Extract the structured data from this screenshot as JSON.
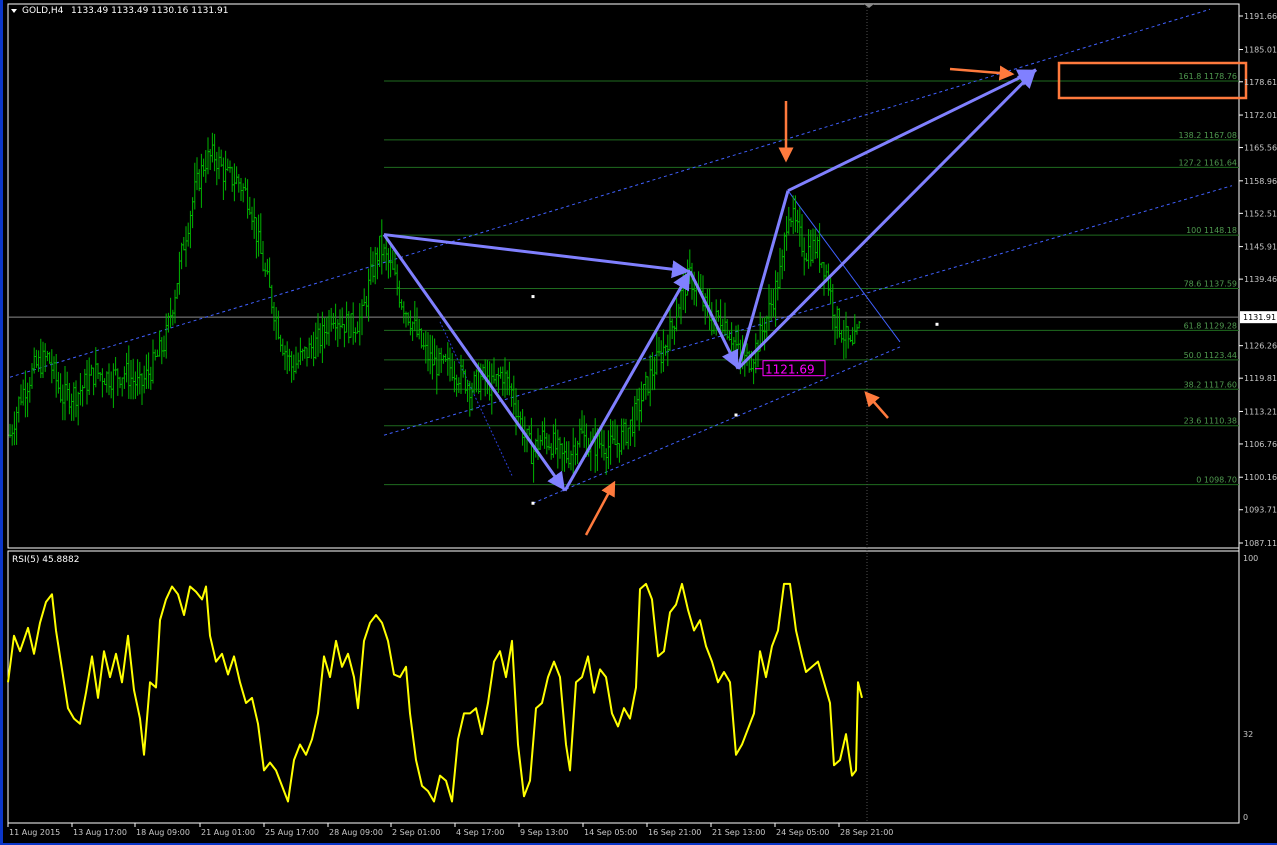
{
  "window": {
    "symbol_label": "GOLD,H4",
    "ohlc_label": "1133.49 1133.49 1130.16 1131.91",
    "rsi_label": "RSI(5) 45.8882"
  },
  "colors": {
    "background": "#000000",
    "bar": "#00b400",
    "grid_line": "#1f6b1f",
    "fib_text": "#4f9a4f",
    "axis_text": "#c8c8c8",
    "pattern": "#8080ff",
    "channel": "#4060ff",
    "arrow": "#ff7a3d",
    "target_box": "#ff7a3d",
    "rsi_line": "#ffff00",
    "price_label_box": "#ff00ff",
    "pane_border": "#ffffff",
    "crosshair": "#8a8a8a"
  },
  "chart_data": [
    {
      "type": "ohlc",
      "symbol": "GOLD",
      "timeframe": "H4",
      "current_price": "1131.91",
      "ylim": [
        1087.11,
        1191.66
      ],
      "y_ticks": [
        "1191.66",
        "1185.01",
        "1178.61",
        "1172.01",
        "1165.56",
        "1158.96",
        "1152.51",
        "1145.91",
        "1139.46",
        "1131.91",
        "1126.26",
        "1119.81",
        "1113.21",
        "1106.76",
        "1100.16",
        "1093.71",
        "1087.11"
      ],
      "x_ticks": [
        "11 Aug 2015",
        "13 Aug 17:00",
        "18 Aug 09:00",
        "21 Aug 01:00",
        "25 Aug 17:00",
        "28 Aug 09:00",
        "2 Sep 01:00",
        "4 Sep 17:00",
        "9 Sep 13:00",
        "14 Sep 05:00",
        "16 Sep 21:00",
        "21 Sep 13:00",
        "24 Sep 05:00",
        "28 Sep 21:00"
      ],
      "fib_levels": [
        {
          "label": "161.8 1178.76",
          "value": 1178.76
        },
        {
          "label": "138.2 1167.08",
          "value": 1167.08
        },
        {
          "label": "127.2 1161.64",
          "value": 1161.64
        },
        {
          "label": "100 1148.18",
          "value": 1148.18
        },
        {
          "label": "78.6 1137.59",
          "value": 1137.59
        },
        {
          "label": "61.8 1129.28",
          "value": 1129.28
        },
        {
          "label": "50.0 1123.44",
          "value": 1123.44
        },
        {
          "label": "38.2 1117.60",
          "value": 1117.6
        },
        {
          "label": "23.6 1110.38",
          "value": 1110.38
        },
        {
          "label": "0 1098.70",
          "value": 1098.7
        }
      ],
      "price_label": "1121.69",
      "price_path": [
        [
          0,
          1097
        ],
        [
          8,
          1107
        ],
        [
          20,
          1116
        ],
        [
          35,
          1122
        ],
        [
          48,
          1124
        ],
        [
          62,
          1116
        ],
        [
          78,
          1117
        ],
        [
          95,
          1121
        ],
        [
          110,
          1120
        ],
        [
          125,
          1121
        ],
        [
          140,
          1118
        ],
        [
          152,
          1122
        ],
        [
          165,
          1127
        ],
        [
          175,
          1137
        ],
        [
          185,
          1148
        ],
        [
          195,
          1157
        ],
        [
          205,
          1163
        ],
        [
          215,
          1164
        ],
        [
          225,
          1160
        ],
        [
          238,
          1159
        ],
        [
          250,
          1155
        ],
        [
          262,
          1143
        ],
        [
          272,
          1135
        ],
        [
          282,
          1127
        ],
        [
          292,
          1122
        ],
        [
          302,
          1124
        ],
        [
          312,
          1126
        ],
        [
          322,
          1128
        ],
        [
          332,
          1133
        ],
        [
          342,
          1131
        ],
        [
          352,
          1130
        ],
        [
          362,
          1132
        ],
        [
          372,
          1141
        ],
        [
          380,
          1146
        ],
        [
          392,
          1141
        ],
        [
          402,
          1135
        ],
        [
          412,
          1131
        ],
        [
          422,
          1126
        ],
        [
          432,
          1123
        ],
        [
          442,
          1122
        ],
        [
          452,
          1122
        ],
        [
          462,
          1120
        ],
        [
          472,
          1118
        ],
        [
          482,
          1120
        ],
        [
          492,
          1118
        ],
        [
          502,
          1121
        ],
        [
          512,
          1117
        ],
        [
          522,
          1110
        ],
        [
          532,
          1105
        ],
        [
          542,
          1108
        ],
        [
          552,
          1107
        ],
        [
          562,
          1104
        ],
        [
          570,
          1105
        ],
        [
          580,
          1109
        ],
        [
          590,
          1106
        ],
        [
          600,
          1107
        ],
        [
          612,
          1106
        ],
        [
          622,
          1108
        ],
        [
          632,
          1111
        ],
        [
          642,
          1116
        ],
        [
          652,
          1121
        ],
        [
          662,
          1125
        ],
        [
          672,
          1130
        ],
        [
          682,
          1137
        ],
        [
          690,
          1140
        ],
        [
          700,
          1136
        ],
        [
          712,
          1131
        ],
        [
          722,
          1132
        ],
        [
          732,
          1128
        ],
        [
          742,
          1123
        ],
        [
          752,
          1124
        ],
        [
          762,
          1129
        ],
        [
          772,
          1135
        ],
        [
          782,
          1142
        ],
        [
          788,
          1154
        ],
        [
          795,
          1150
        ],
        [
          805,
          1145
        ],
        [
          815,
          1146
        ],
        [
          825,
          1142
        ],
        [
          835,
          1132
        ],
        [
          845,
          1128
        ],
        [
          852,
          1125
        ],
        [
          860,
          1130
        ]
      ],
      "pattern_points": [
        [
          384,
          1148.3
        ],
        [
          565,
          1097.5
        ],
        [
          690,
          1141
        ],
        [
          738,
          1121.69
        ],
        [
          1036,
          1181
        ]
      ],
      "channel_upper": [
        [
          10,
          1120
        ],
        [
          1210,
          1193
        ]
      ],
      "channel_mid": [
        [
          384,
          1108.5
        ],
        [
          1232,
          1158
        ]
      ],
      "channel_lower": [
        [
          533,
          1095
        ],
        [
          900,
          1126
        ]
      ],
      "dotted_line": [
        [
          440,
          1131
        ],
        [
          512,
          1100.5
        ]
      ],
      "thin_blue_line": [
        [
          788,
          1157
        ],
        [
          900,
          1127
        ]
      ],
      "dot_markers": [
        [
          533,
          1136
        ],
        [
          533,
          1095
        ],
        [
          736,
          1112.5
        ],
        [
          937,
          1130.5
        ]
      ],
      "cursor_x": 867
    },
    {
      "type": "line",
      "name": "RSI(5)",
      "current_value": 45.8882,
      "ylim": [
        0,
        100
      ],
      "y_ticks": [
        "100",
        "32",
        "0"
      ],
      "values_path": [
        [
          8,
          52
        ],
        [
          14,
          70
        ],
        [
          20,
          64
        ],
        [
          28,
          73
        ],
        [
          34,
          63
        ],
        [
          40,
          75
        ],
        [
          46,
          83
        ],
        [
          52,
          86
        ],
        [
          56,
          72
        ],
        [
          62,
          57
        ],
        [
          68,
          42
        ],
        [
          74,
          38
        ],
        [
          80,
          36
        ],
        [
          86,
          48
        ],
        [
          92,
          62
        ],
        [
          98,
          46
        ],
        [
          104,
          64
        ],
        [
          110,
          54
        ],
        [
          116,
          63
        ],
        [
          122,
          52
        ],
        [
          128,
          70
        ],
        [
          134,
          49
        ],
        [
          140,
          38
        ],
        [
          144,
          24
        ],
        [
          150,
          52
        ],
        [
          156,
          50
        ],
        [
          160,
          76
        ],
        [
          166,
          84
        ],
        [
          172,
          89
        ],
        [
          178,
          86
        ],
        [
          184,
          78
        ],
        [
          190,
          89
        ],
        [
          196,
          87
        ],
        [
          202,
          84
        ],
        [
          206,
          89
        ],
        [
          210,
          70
        ],
        [
          216,
          60
        ],
        [
          222,
          63
        ],
        [
          228,
          55
        ],
        [
          234,
          62
        ],
        [
          240,
          52
        ],
        [
          246,
          44
        ],
        [
          252,
          46
        ],
        [
          258,
          36
        ],
        [
          264,
          18
        ],
        [
          270,
          21
        ],
        [
          276,
          18
        ],
        [
          282,
          12
        ],
        [
          288,
          6
        ],
        [
          294,
          22
        ],
        [
          300,
          28
        ],
        [
          306,
          24
        ],
        [
          312,
          30
        ],
        [
          318,
          40
        ],
        [
          324,
          62
        ],
        [
          330,
          54
        ],
        [
          336,
          68
        ],
        [
          342,
          58
        ],
        [
          348,
          63
        ],
        [
          354,
          54
        ],
        [
          358,
          42
        ],
        [
          364,
          68
        ],
        [
          370,
          75
        ],
        [
          376,
          78
        ],
        [
          382,
          75
        ],
        [
          388,
          68
        ],
        [
          394,
          55
        ],
        [
          400,
          54
        ],
        [
          406,
          58
        ],
        [
          410,
          40
        ],
        [
          416,
          22
        ],
        [
          422,
          12
        ],
        [
          428,
          10
        ],
        [
          434,
          6
        ],
        [
          440,
          16
        ],
        [
          446,
          14
        ],
        [
          452,
          6
        ],
        [
          458,
          30
        ],
        [
          464,
          40
        ],
        [
          470,
          40
        ],
        [
          476,
          42
        ],
        [
          482,
          32
        ],
        [
          488,
          44
        ],
        [
          494,
          60
        ],
        [
          500,
          64
        ],
        [
          506,
          54
        ],
        [
          512,
          68
        ],
        [
          518,
          28
        ],
        [
          524,
          8
        ],
        [
          530,
          14
        ],
        [
          536,
          42
        ],
        [
          542,
          44
        ],
        [
          548,
          54
        ],
        [
          554,
          60
        ],
        [
          560,
          54
        ],
        [
          566,
          28
        ],
        [
          570,
          18
        ],
        [
          576,
          52
        ],
        [
          582,
          54
        ],
        [
          588,
          62
        ],
        [
          594,
          48
        ],
        [
          600,
          57
        ],
        [
          606,
          54
        ],
        [
          612,
          40
        ],
        [
          618,
          35
        ],
        [
          624,
          42
        ],
        [
          630,
          38
        ],
        [
          636,
          50
        ],
        [
          640,
          88
        ],
        [
          646,
          90
        ],
        [
          652,
          84
        ],
        [
          658,
          62
        ],
        [
          664,
          64
        ],
        [
          670,
          79
        ],
        [
          676,
          82
        ],
        [
          682,
          90
        ],
        [
          688,
          80
        ],
        [
          694,
          72
        ],
        [
          700,
          76
        ],
        [
          706,
          66
        ],
        [
          712,
          60
        ],
        [
          718,
          52
        ],
        [
          724,
          56
        ],
        [
          730,
          52
        ],
        [
          736,
          24
        ],
        [
          742,
          28
        ],
        [
          748,
          34
        ],
        [
          754,
          40
        ],
        [
          760,
          64
        ],
        [
          766,
          54
        ],
        [
          772,
          66
        ],
        [
          778,
          72
        ],
        [
          784,
          90
        ],
        [
          790,
          90
        ],
        [
          796,
          72
        ],
        [
          802,
          62
        ],
        [
          806,
          56
        ],
        [
          812,
          58
        ],
        [
          818,
          60
        ],
        [
          824,
          52
        ],
        [
          830,
          44
        ],
        [
          834,
          20
        ],
        [
          840,
          22
        ],
        [
          846,
          32
        ],
        [
          852,
          16
        ],
        [
          856,
          18
        ],
        [
          858,
          52
        ],
        [
          862,
          46
        ]
      ]
    }
  ]
}
